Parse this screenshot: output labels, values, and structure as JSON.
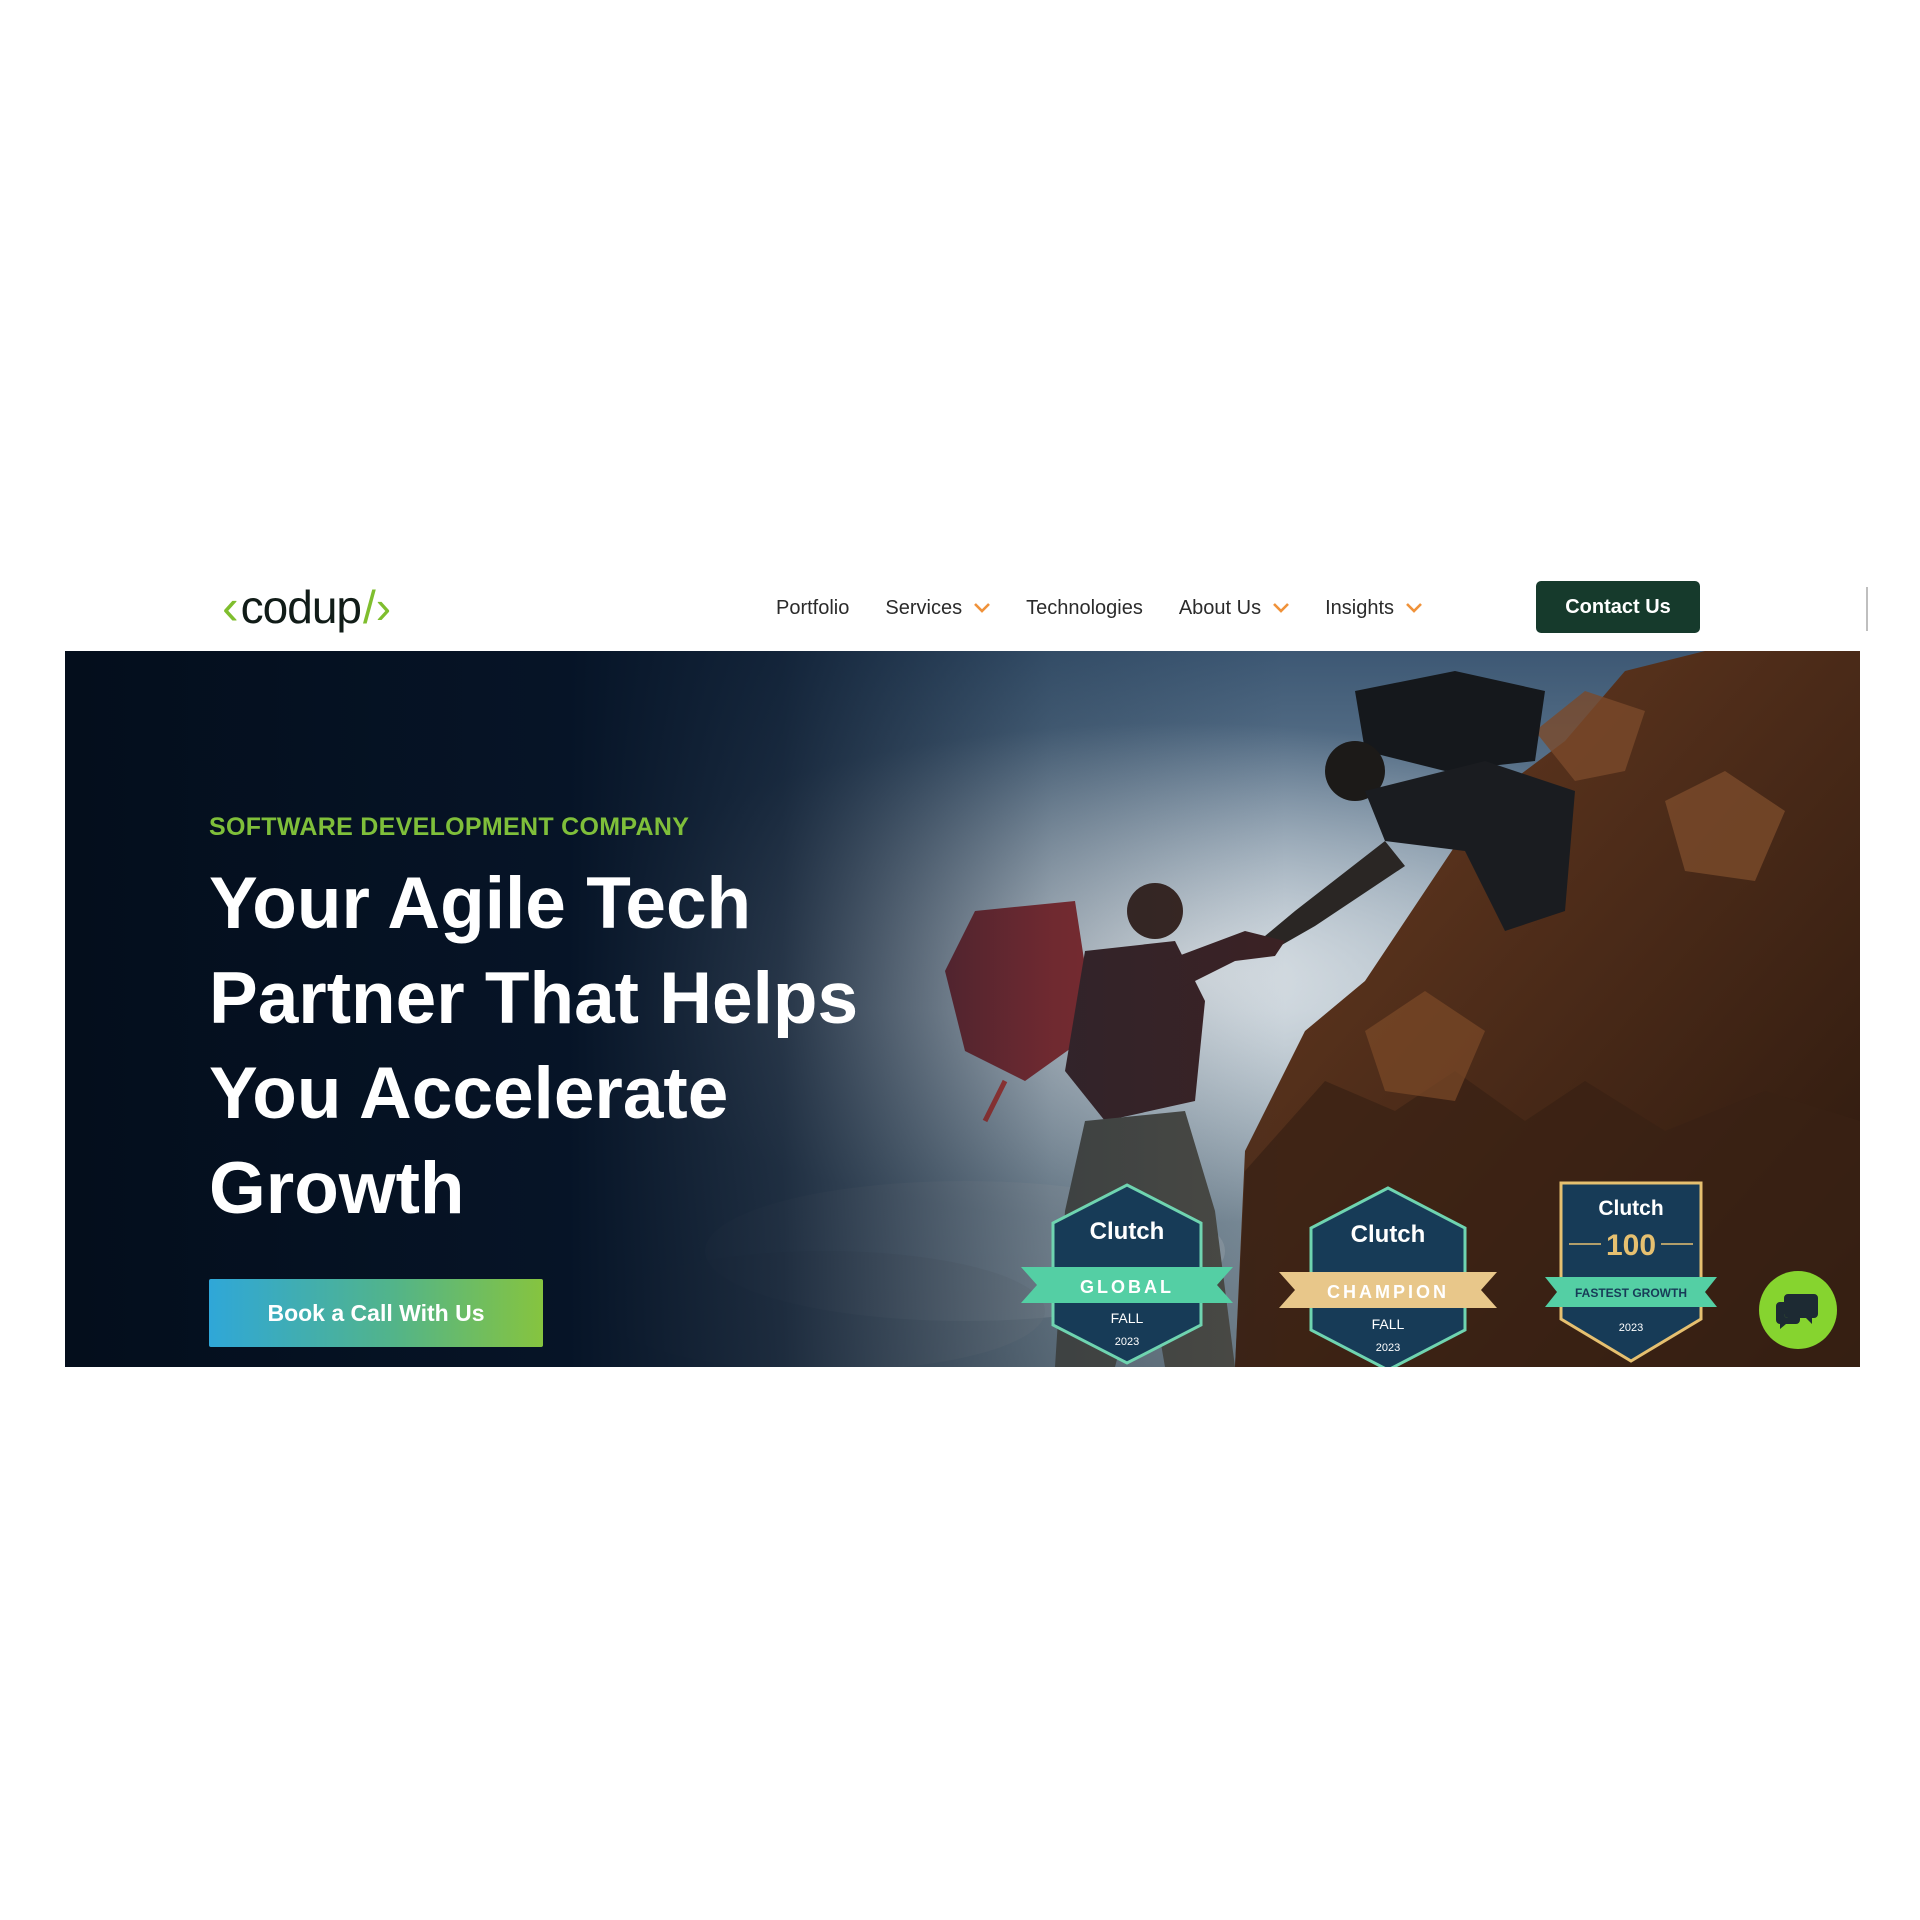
{
  "header": {
    "logo": {
      "open": "‹",
      "word": "codup",
      "close": "/›"
    },
    "nav": [
      {
        "label": "Portfolio",
        "dropdown": false
      },
      {
        "label": "Services",
        "dropdown": true
      },
      {
        "label": "Technologies",
        "dropdown": false
      },
      {
        "label": "About Us",
        "dropdown": true
      },
      {
        "label": "Insights",
        "dropdown": true
      }
    ],
    "contact_label": "Contact Us"
  },
  "hero": {
    "eyebrow": "SOFTWARE DEVELOPMENT COMPANY",
    "headline_lines": [
      "Your Agile Tech",
      "Partner That Helps",
      "You Accelerate",
      "Growth"
    ],
    "cta_label": "Book a Call With Us"
  },
  "badges": [
    {
      "brand": "Clutch",
      "ribbon": "GLOBAL",
      "season": "FALL",
      "year": "2023"
    },
    {
      "brand": "Clutch",
      "ribbon": "CHAMPION",
      "season": "FALL",
      "year": "2023"
    },
    {
      "brand": "Clutch",
      "number": "100",
      "ribbon": "FASTEST GROWTH",
      "year": "2023"
    }
  ],
  "icons": {
    "nav_dropdown": "chevron-down-icon",
    "chat": "chat-bubble-icon",
    "logo": "codup-logo"
  },
  "colors": {
    "brand_green": "#7fbe2e",
    "contact_button": "#163a2c",
    "nav_chevron": "#f0923a",
    "hero_dark": "#061427",
    "cta_gradient_start": "#2fa7d8",
    "cta_gradient_end": "#86c43f",
    "chat_button": "#86d42f",
    "badge_navy": "#173b57",
    "badge_mint": "#54cfa4",
    "badge_gold": "#e8c78a"
  }
}
